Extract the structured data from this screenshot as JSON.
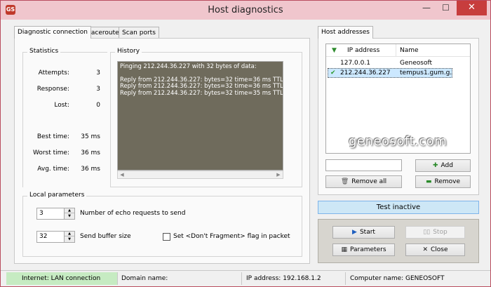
{
  "window": {
    "title": "Host diagnostics",
    "icon_label": "GS",
    "minimize_glyph": "—",
    "maximize_glyph": "☐",
    "close_glyph": "✕"
  },
  "left_tabs": [
    {
      "label": "Diagnostic connection",
      "active": true
    },
    {
      "label": "Traceroute",
      "active": false
    },
    {
      "label": "Scan ports",
      "active": false
    }
  ],
  "statistics": {
    "title": "Statistics",
    "rows": [
      {
        "label": "Attempts:",
        "value": "3"
      },
      {
        "label": "Response:",
        "value": "3"
      },
      {
        "label": "Lost:",
        "value": "0"
      },
      {
        "label": "Best time:",
        "value": "35 ms"
      },
      {
        "label": "Worst time:",
        "value": "36 ms"
      },
      {
        "label": "Avg. time:",
        "value": "36 ms"
      }
    ]
  },
  "history": {
    "title": "History",
    "lines": [
      "Pinging 212.244.36.227 with 32 bytes of data:",
      "",
      "Reply from 212.244.36.227: bytes=32 time=36 ms TTL=61",
      "Reply from 212.244.36.227: bytes=32 time=36 ms TTL=61",
      "Reply from 212.244.36.227: bytes=32 time=35 ms TTL=61"
    ]
  },
  "local_params": {
    "title": "Local parameters",
    "echo_count": "3",
    "echo_label": "Number of echo requests to send",
    "buffer_size": "32",
    "buffer_label": "Send buffer size",
    "dont_fragment_label": "Set <Don't Fragment> flag in packet",
    "dont_fragment_checked": false
  },
  "host_tab": {
    "label": "Host addresses"
  },
  "host_list": {
    "columns": [
      "IP address",
      "Name"
    ],
    "rows": [
      {
        "ip": "127.0.0.1",
        "name": "Geneosoft",
        "selected": false
      },
      {
        "ip": "212.244.36.227",
        "name": "tempus1.gum.g...",
        "selected": true
      }
    ]
  },
  "host_controls": {
    "new_host_value": "",
    "add_label": "Add",
    "remove_all_label": "Remove all",
    "remove_label": "Remove"
  },
  "test_status": "Test inactive",
  "actions": {
    "start_label": "Start",
    "stop_label": "Stop",
    "parameters_label": "Parameters",
    "close_label": "Close"
  },
  "statusbar": {
    "internet": "Internet: LAN connection",
    "domain": "Domain name:",
    "ip": "IP address: 192.168.1.2",
    "computer": "Computer name: GENEOSOFT"
  },
  "watermark": "geneosoft.com",
  "colors": {
    "title_bar": "#f0c6cd",
    "close_button": "#c73d3d",
    "history_bg": "#6f6b5c",
    "selected_row": "#cce8ff",
    "test_bar": "#cde7f6",
    "internet_status": "#c6ebc2"
  }
}
